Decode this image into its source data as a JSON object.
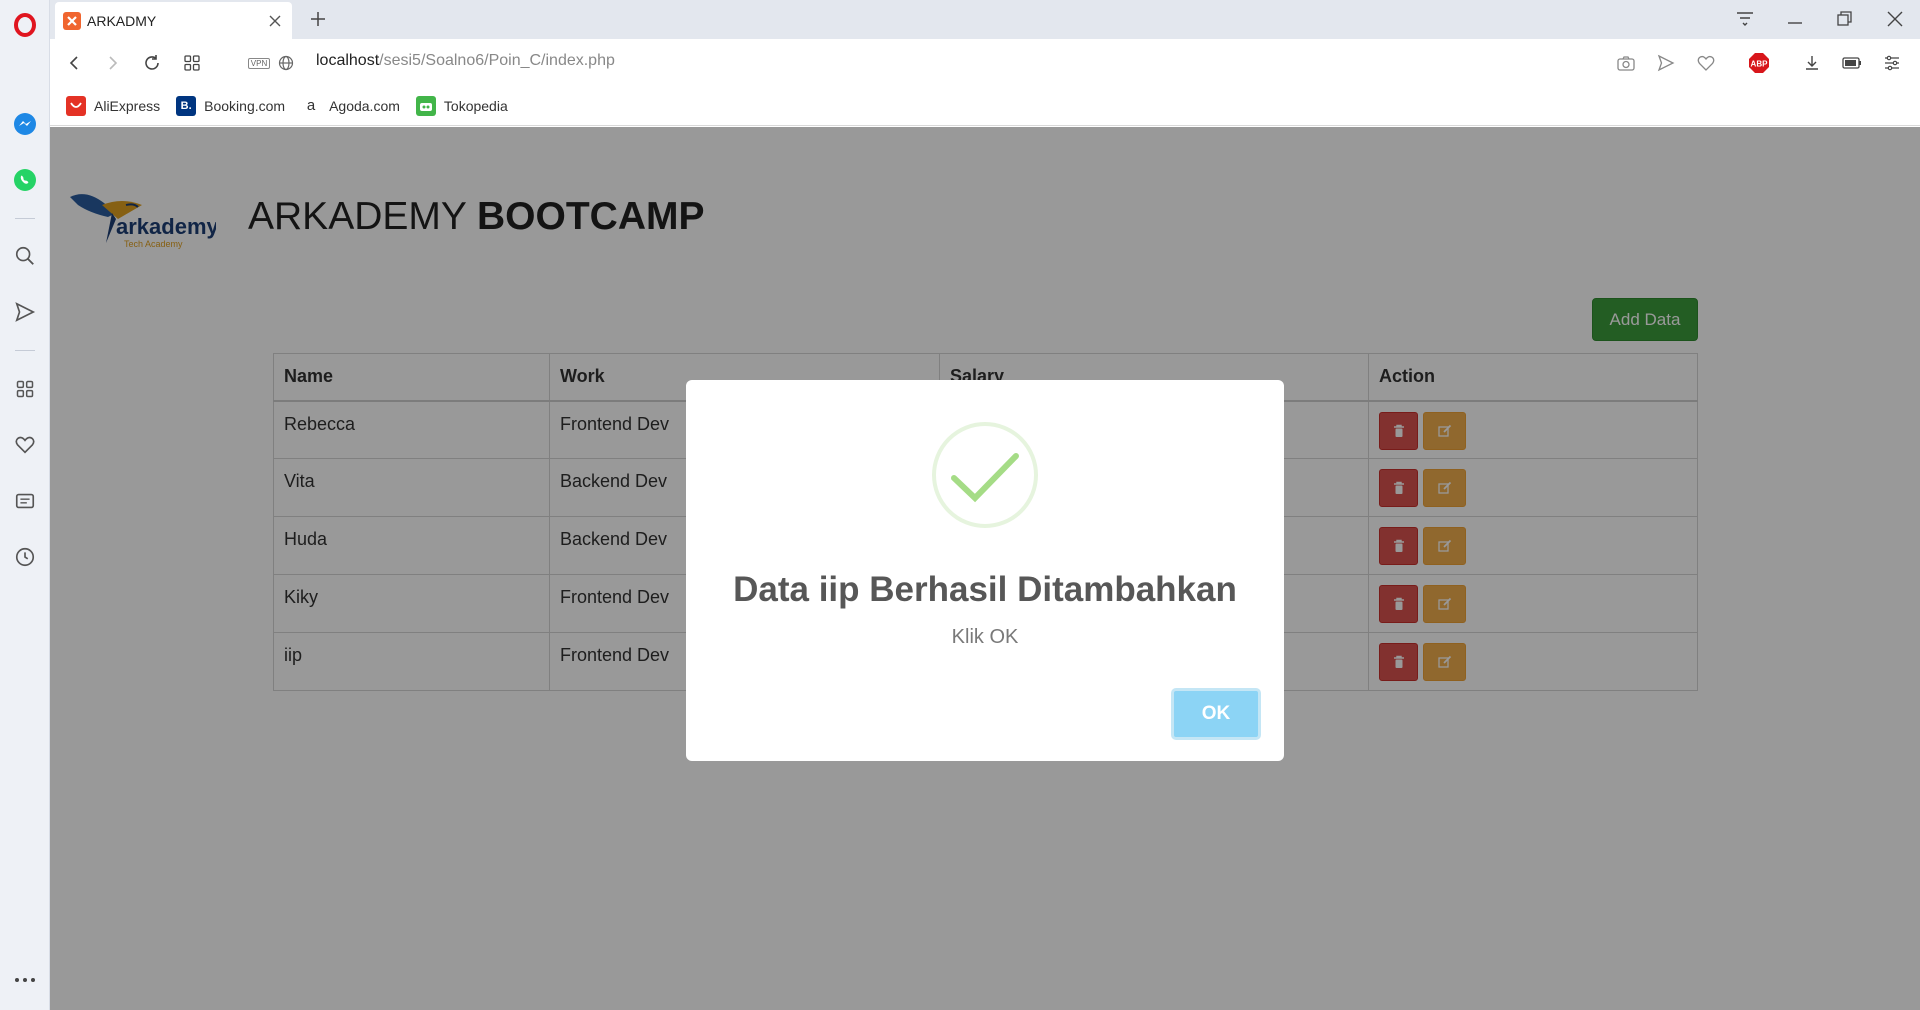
{
  "browser": {
    "tab_title": "ARKADMY",
    "url_host": "localhost",
    "url_path": "/sesi5/Soalno6/Poin_C/index.php",
    "vpn_label": "VPN",
    "abp_label": "ABP"
  },
  "bookmarks": [
    {
      "label": "AliExpress",
      "icon": "aliexpress-icon",
      "color": "#e43225"
    },
    {
      "label": "Booking.com",
      "icon": "booking-icon",
      "color": "#003580"
    },
    {
      "label": "Agoda.com",
      "icon": "agoda-icon",
      "color": "#ffffff"
    },
    {
      "label": "Tokopedia",
      "icon": "tokopedia-icon",
      "color": "#42b549"
    }
  ],
  "page": {
    "logo_text": "arkademy",
    "logo_sub": "Tech Academy",
    "heading_light": "ARKADEMY ",
    "heading_bold": "BOOTCAMP",
    "add_button": "Add Data",
    "table": {
      "headers": [
        "Name",
        "Work",
        "Salary",
        "Action"
      ],
      "rows": [
        {
          "name": "Rebecca",
          "work": "Frontend Dev"
        },
        {
          "name": "Vita",
          "work": "Backend Dev"
        },
        {
          "name": "Huda",
          "work": "Backend Dev"
        },
        {
          "name": "Kiky",
          "work": "Frontend Dev"
        },
        {
          "name": "iip",
          "work": "Frontend Dev"
        }
      ]
    }
  },
  "modal": {
    "title": "Data iip Berhasil Ditambahkan",
    "text": "Klik OK",
    "ok_label": "OK"
  },
  "colors": {
    "success": "#3b9c3b",
    "danger": "#d9534f",
    "warning": "#f0ad4e",
    "ok_button": "#8cd4f5",
    "check": "#a5dc86"
  }
}
